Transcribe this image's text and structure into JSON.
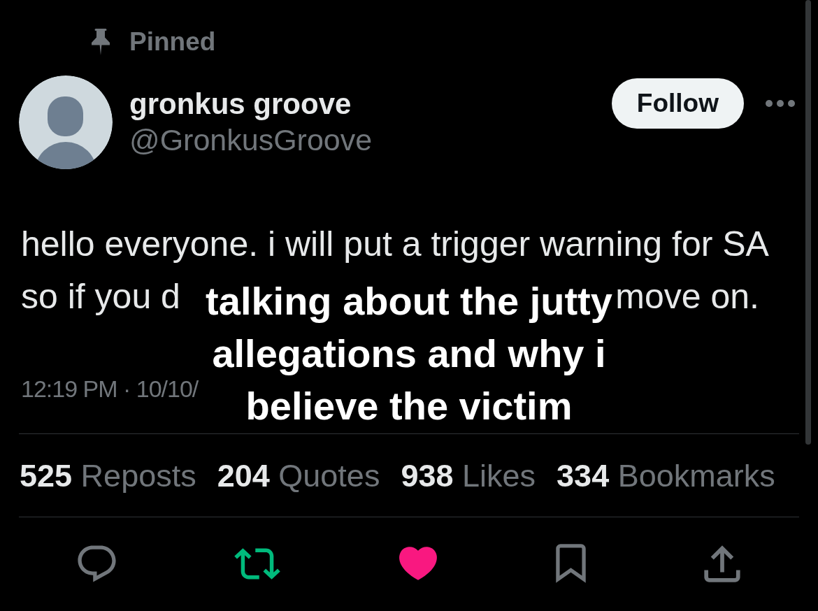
{
  "pinned": {
    "label": "Pinned"
  },
  "author": {
    "name": "gronkus groove",
    "handle": "@GronkusGroove"
  },
  "follow_button": {
    "label": "Follow"
  },
  "body": {
    "line_1": "hello everyone. i will put a trigger warning for SA",
    "line_2_start": "so if you d",
    "line_2_end": "move on."
  },
  "meta": "12:19 PM · 10/10/",
  "stats": [
    {
      "count": "525",
      "label": "Reposts"
    },
    {
      "count": "204",
      "label": "Quotes"
    },
    {
      "count": "938",
      "label": "Likes"
    },
    {
      "count": "334",
      "label": "Bookmarks"
    }
  ],
  "actions": [
    {
      "kind": "reply"
    },
    {
      "kind": "repost",
      "on": true
    },
    {
      "kind": "like",
      "on": true
    },
    {
      "kind": "bookmark",
      "on": false
    },
    {
      "kind": "share"
    }
  ],
  "caption": "talking about the jutty allegations and why i believe the victim"
}
